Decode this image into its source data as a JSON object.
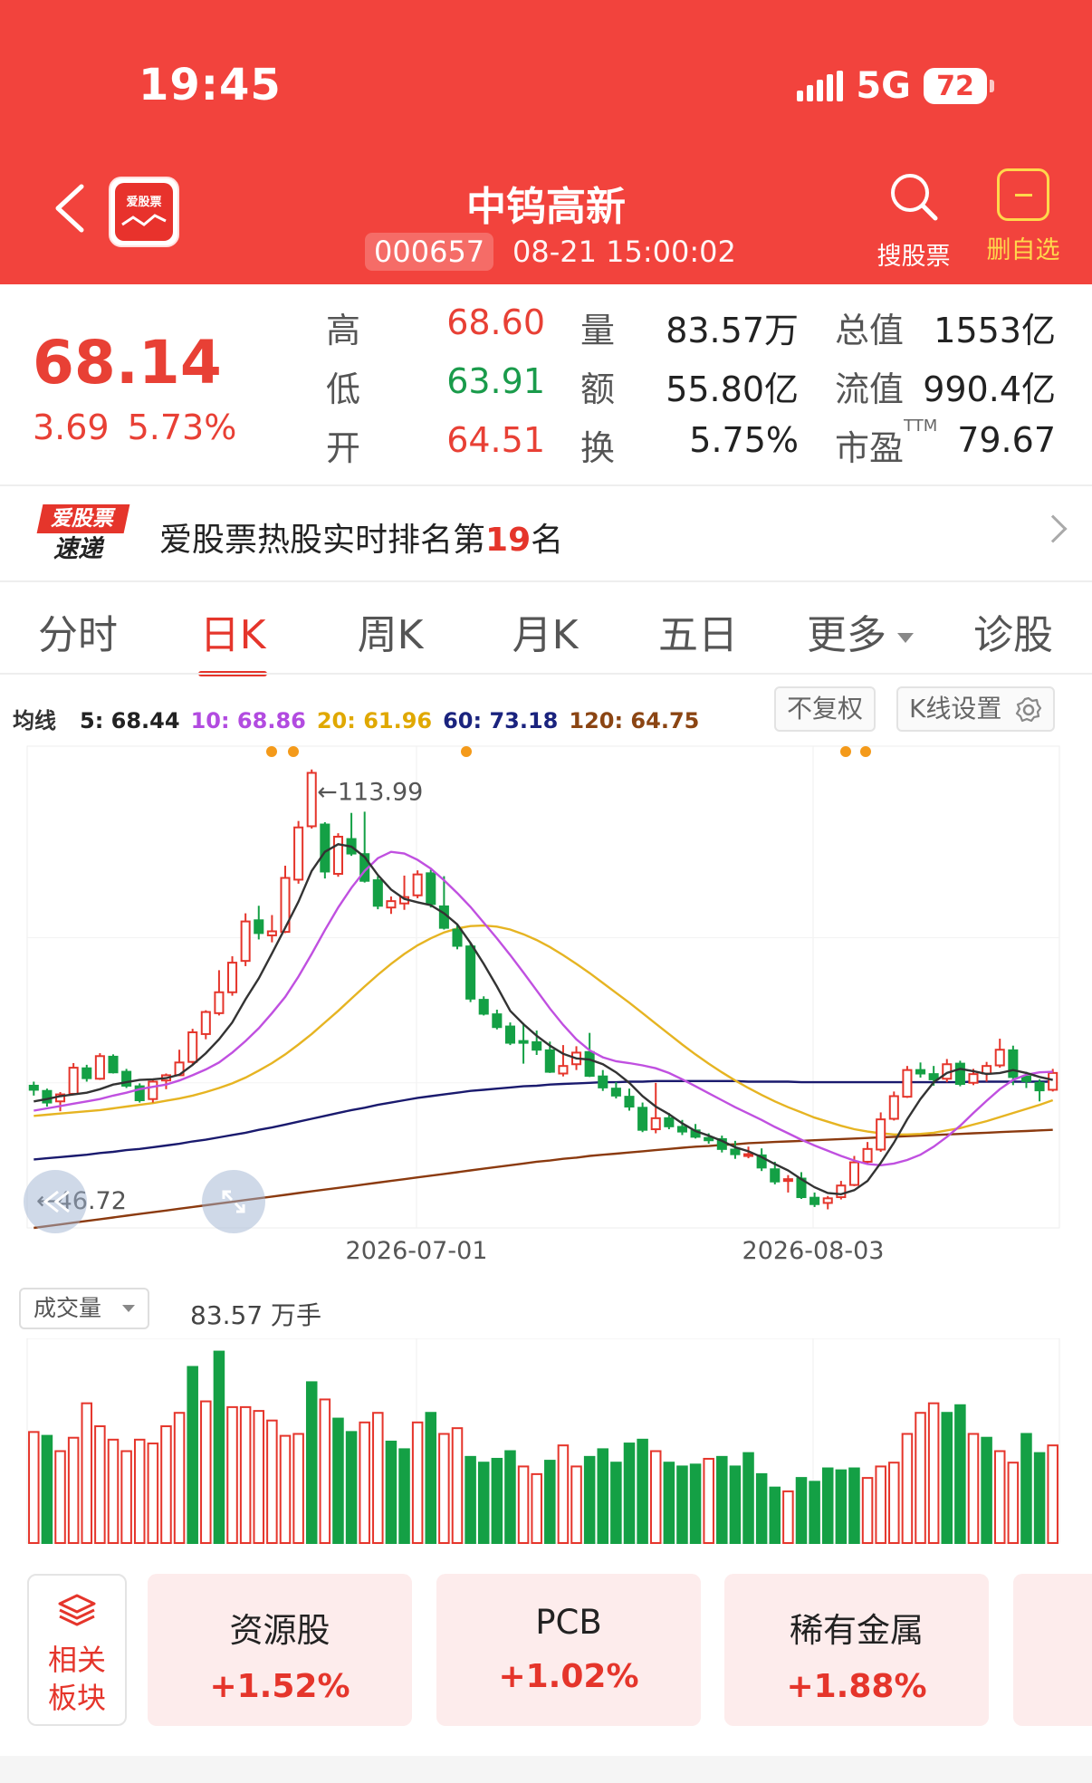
{
  "status_bar": {
    "time": "19:45",
    "network": "5G",
    "battery": "72"
  },
  "header": {
    "logo_text": "爱股票",
    "stock_name": "中钨高新",
    "stock_code": "000657",
    "timestamp": "08-21 15:00:02",
    "search_label": "搜股票",
    "remove_label": "删自选"
  },
  "quote": {
    "price": "68.14",
    "change": "3.69",
    "change_pct": "5.73%",
    "high_label": "高",
    "high": "68.60",
    "low_label": "低",
    "low": "63.91",
    "open_label": "开",
    "open": "64.51",
    "volume_label": "量",
    "volume": "83.57万",
    "amount_label": "额",
    "amount": "55.80亿",
    "turnover_label": "换",
    "turnover": "5.75%",
    "mktcap_label": "总值",
    "mktcap": "1553亿",
    "float_label": "流值",
    "float_cap": "990.4亿",
    "pe_label": "市盈",
    "pe_sup": "TTM",
    "pe": "79.67"
  },
  "hot_rank": {
    "logo_top": "爱股票",
    "logo_bottom": "速递",
    "text_prefix": "爱股票热股实时排名第",
    "rank": "19",
    "text_suffix": "名"
  },
  "tabs": [
    "分时",
    "日K",
    "周K",
    "月K",
    "五日",
    "更多",
    "诊股"
  ],
  "active_tab": 1,
  "chart_controls": {
    "adjust": "不复权",
    "settings": "K线设置"
  },
  "ma": {
    "title": "均线",
    "items": [
      {
        "label": "5: 68.44",
        "color": "#222222"
      },
      {
        "label": "10: 68.86",
        "color": "#b24be0"
      },
      {
        "label": "20: 61.96",
        "color": "#e0a800"
      },
      {
        "label": "60: 73.18",
        "color": "#1a237e"
      },
      {
        "label": "120: 64.75",
        "color": "#8b4513"
      }
    ]
  },
  "colors": {
    "up": "#e5352b",
    "down": "#14a045",
    "header": "#f2433d",
    "ma5": "#333333",
    "ma10": "#c050e0",
    "ma20": "#e6b422",
    "ma60": "#1a1a6e",
    "ma120": "#8b3a0f"
  },
  "chart_data": {
    "type": "candlestick",
    "title": "",
    "y_range": [
      46.72,
      113.99
    ],
    "max_label": "←113.99",
    "min_label": "←46.72",
    "x_tick_labels": [
      "2026-07-01",
      "2026-08-03"
    ],
    "candles": [
      [
        59.5,
        58.8,
        60.2,
        57.8
      ],
      [
        58.6,
        56.6,
        59.0,
        55.9
      ],
      [
        56.8,
        58.0,
        58.4,
        55.1
      ],
      [
        58.1,
        62.6,
        63.4,
        57.9
      ],
      [
        62.5,
        60.8,
        63.1,
        60.2
      ],
      [
        60.7,
        64.6,
        65.1,
        60.5
      ],
      [
        64.5,
        61.8,
        64.9,
        61.6
      ],
      [
        61.9,
        59.5,
        62.4,
        59.1
      ],
      [
        59.4,
        57.0,
        59.9,
        56.6
      ],
      [
        57.2,
        60.2,
        60.5,
        56.6
      ],
      [
        60.4,
        61.3,
        61.6,
        58.9
      ],
      [
        61.3,
        63.5,
        65.7,
        61.4
      ],
      [
        63.6,
        68.7,
        69.3,
        63.3
      ],
      [
        68.4,
        72.2,
        72.5,
        67.5
      ],
      [
        72.0,
        75.6,
        79.4,
        71.6
      ],
      [
        75.6,
        80.7,
        81.8,
        75.0
      ],
      [
        81.0,
        87.8,
        89.2,
        80.1
      ],
      [
        88.0,
        85.8,
        90.5,
        84.7
      ],
      [
        85.4,
        86.1,
        88.9,
        84.2
      ],
      [
        86.0,
        95.3,
        97.4,
        85.8
      ],
      [
        95.0,
        104.0,
        105.1,
        94.3
      ],
      [
        104.2,
        113.4,
        113.99,
        103.8
      ],
      [
        104.5,
        96.4,
        104.9,
        95.2
      ],
      [
        96.0,
        102.4,
        103.0,
        95.5
      ],
      [
        102.0,
        99.5,
        106.5,
        99.1
      ],
      [
        99.4,
        94.8,
        106.7,
        94.5
      ],
      [
        94.9,
        90.5,
        95.6,
        89.9
      ],
      [
        90.2,
        91.3,
        92.1,
        89.1
      ],
      [
        90.9,
        92.0,
        95.7,
        89.8
      ],
      [
        92.3,
        95.9,
        96.6,
        91.8
      ],
      [
        96.1,
        90.8,
        96.7,
        90.2
      ],
      [
        90.4,
        86.7,
        95.6,
        86.4
      ],
      [
        86.4,
        83.6,
        87.4,
        83.0
      ],
      [
        83.5,
        74.5,
        84.2,
        73.9
      ],
      [
        74.3,
        71.9,
        74.9,
        71.6
      ],
      [
        71.8,
        69.6,
        72.6,
        69.2
      ],
      [
        69.7,
        66.9,
        70.4,
        66.5
      ],
      [
        67.2,
        67.1,
        70.3,
        63.3
      ],
      [
        67.0,
        65.7,
        69.0,
        64.8
      ],
      [
        65.6,
        61.9,
        67.1,
        61.7
      ],
      [
        61.6,
        62.9,
        66.5,
        61.1
      ],
      [
        63.2,
        65.2,
        66.3,
        62.2
      ],
      [
        65.3,
        61.2,
        68.6,
        61.0
      ],
      [
        61.1,
        59.2,
        62.2,
        58.6
      ],
      [
        59.0,
        57.8,
        60.1,
        57.3
      ],
      [
        57.6,
        55.9,
        59.0,
        55.2
      ],
      [
        55.7,
        51.9,
        56.6,
        51.5
      ],
      [
        52.0,
        53.9,
        60.0,
        51.3
      ],
      [
        53.9,
        52.5,
        54.8,
        52.0
      ],
      [
        52.4,
        51.6,
        53.6,
        51.0
      ],
      [
        51.8,
        50.7,
        52.9,
        50.4
      ],
      [
        50.5,
        50.1,
        51.3,
        49.5
      ],
      [
        50.3,
        48.6,
        50.9,
        48.0
      ],
      [
        48.5,
        47.7,
        50.0,
        46.9
      ],
      [
        47.7,
        47.7,
        49.0,
        47.0
      ],
      [
        47.5,
        45.4,
        48.7,
        44.8
      ],
      [
        45.1,
        43.0,
        46.4,
        42.5
      ],
      [
        43.3,
        43.4,
        44.1,
        41.1
      ],
      [
        43.5,
        40.3,
        44.6,
        40.0
      ],
      [
        40.2,
        39.1,
        41.1,
        38.6
      ],
      [
        39.3,
        40.1,
        40.5,
        38.2
      ],
      [
        40.3,
        42.3,
        43.1,
        39.9
      ],
      [
        42.4,
        46.3,
        47.4,
        42.2
      ],
      [
        46.4,
        48.6,
        49.8,
        46.1
      ],
      [
        48.5,
        53.7,
        54.9,
        48.1
      ],
      [
        53.8,
        57.7,
        58.5,
        53.5
      ],
      [
        57.6,
        62.2,
        62.9,
        57.4
      ],
      [
        62.2,
        61.6,
        63.5,
        60.9
      ],
      [
        61.5,
        60.6,
        62.9,
        59.5
      ],
      [
        60.7,
        63.2,
        64.1,
        60.1
      ],
      [
        63.3,
        59.8,
        63.8,
        59.4
      ],
      [
        60.0,
        61.5,
        62.4,
        59.6
      ],
      [
        61.6,
        62.9,
        63.6,
        60.2
      ],
      [
        63.0,
        65.7,
        67.6,
        62.6
      ],
      [
        65.6,
        61.0,
        66.4,
        59.6
      ],
      [
        61.1,
        60.3,
        61.9,
        59.1
      ],
      [
        60.0,
        58.7,
        60.6,
        56.8
      ],
      [
        58.8,
        61.7,
        62.4,
        58.5
      ]
    ],
    "ma5": [
      56.8,
      57.2,
      57.7,
      58.0,
      58.3,
      58.9,
      59.7,
      60.1,
      60.5,
      60.6,
      60.8,
      61.4,
      63.1,
      65.1,
      67.5,
      70.4,
      74.4,
      78.0,
      82.3,
      86.7,
      91.2,
      96.5,
      99.8,
      101.1,
      100.7,
      98.9,
      95.8,
      93.3,
      91.7,
      91.1,
      90.6,
      89.2,
      87.3,
      84.1,
      80.5,
      76.6,
      72.4,
      70.1,
      68.1,
      66.4,
      65.0,
      64.2,
      64.0,
      63.2,
      61.8,
      60.0,
      57.7,
      55.9,
      54.6,
      53.0,
      51.7,
      50.9,
      50.0,
      48.9,
      48.2,
      47.2,
      46.0,
      44.9,
      43.4,
      42.0,
      41.0,
      40.8,
      41.5,
      43.1,
      46.2,
      49.7,
      53.7,
      57.2,
      60.1,
      61.7,
      62.4,
      62.0,
      61.5,
      61.7,
      62.2,
      61.7,
      61.0,
      60.5
    ],
    "ma10": [
      55.2,
      55.6,
      56.0,
      56.4,
      56.8,
      57.2,
      57.8,
      58.3,
      58.9,
      59.3,
      59.7,
      60.4,
      61.3,
      62.3,
      63.5,
      65.2,
      67.2,
      69.4,
      72.0,
      74.8,
      78.3,
      82.2,
      86.3,
      90.2,
      93.6,
      96.5,
      98.7,
      99.8,
      99.5,
      98.4,
      96.9,
      94.9,
      92.7,
      90.3,
      87.6,
      84.9,
      82.0,
      79.0,
      75.9,
      72.8,
      70.0,
      67.5,
      65.6,
      64.4,
      63.7,
      63.4,
      63.0,
      62.5,
      61.7,
      60.6,
      59.4,
      58.2,
      57.0,
      55.8,
      54.7,
      53.6,
      52.4,
      51.3,
      50.2,
      49.2,
      48.3,
      47.4,
      46.6,
      46.0,
      45.8,
      46.1,
      46.7,
      47.6,
      49.0,
      50.7,
      52.6,
      54.8,
      56.9,
      58.9,
      60.5,
      61.4,
      61.8,
      61.9
    ],
    "ma20": [
      54.3,
      54.5,
      54.7,
      54.9,
      55.1,
      55.3,
      55.6,
      55.9,
      56.2,
      56.5,
      56.9,
      57.3,
      57.8,
      58.4,
      59.1,
      59.9,
      60.9,
      62.1,
      63.4,
      64.9,
      66.6,
      68.4,
      70.4,
      72.4,
      74.5,
      76.6,
      78.6,
      80.5,
      82.2,
      83.7,
      84.9,
      85.9,
      86.6,
      87.0,
      87.1,
      86.9,
      86.4,
      85.6,
      84.6,
      83.4,
      82.0,
      80.5,
      78.9,
      77.2,
      75.5,
      73.8,
      72.0,
      70.2,
      68.4,
      66.6,
      64.9,
      63.3,
      61.8,
      60.4,
      59.1,
      57.9,
      56.8,
      55.8,
      54.9,
      54.0,
      53.3,
      52.6,
      52.0,
      51.6,
      51.3,
      51.1,
      51.1,
      51.2,
      51.4,
      51.8,
      52.2,
      52.8,
      53.4,
      54.1,
      54.8,
      55.5,
      56.2,
      57.0
    ],
    "ma60": [
      46.8,
      47.0,
      47.2,
      47.4,
      47.6,
      47.9,
      48.1,
      48.4,
      48.6,
      48.9,
      49.2,
      49.5,
      49.9,
      50.2,
      50.6,
      51.0,
      51.4,
      51.9,
      52.3,
      52.8,
      53.3,
      53.8,
      54.3,
      54.8,
      55.3,
      55.7,
      56.2,
      56.6,
      57.0,
      57.4,
      57.7,
      58.0,
      58.3,
      58.6,
      58.8,
      59.0,
      59.2,
      59.4,
      59.5,
      59.7,
      59.8,
      59.9,
      60.0,
      60.1,
      60.1,
      60.2,
      60.2,
      60.3,
      60.3,
      60.3,
      60.3,
      60.3,
      60.3,
      60.3,
      60.2,
      60.2,
      60.2,
      60.2,
      60.1,
      60.1,
      60.1,
      60.1,
      60.1,
      60.1,
      60.1,
      60.1,
      60.1,
      60.1,
      60.1,
      60.1,
      60.1,
      60.2,
      60.2,
      60.2,
      60.2,
      60.2,
      60.2,
      60.2
    ],
    "ma120": [
      35.0,
      35.3,
      35.6,
      35.9,
      36.2,
      36.5,
      36.8,
      37.1,
      37.4,
      37.7,
      38.0,
      38.3,
      38.6,
      38.9,
      39.2,
      39.5,
      39.8,
      40.1,
      40.4,
      40.7,
      41.0,
      41.3,
      41.6,
      41.9,
      42.2,
      42.5,
      42.8,
      43.1,
      43.4,
      43.7,
      44.0,
      44.3,
      44.6,
      44.9,
      45.2,
      45.5,
      45.8,
      46.1,
      46.4,
      46.6,
      46.9,
      47.1,
      47.4,
      47.6,
      47.8,
      48.0,
      48.2,
      48.4,
      48.6,
      48.8,
      49.0,
      49.1,
      49.3,
      49.4,
      49.6,
      49.7,
      49.8,
      49.9,
      50.0,
      50.1,
      50.2,
      50.3,
      50.4,
      50.5,
      50.6,
      50.7,
      50.8,
      50.9,
      51.0,
      51.1,
      51.2,
      51.3,
      51.4,
      51.5,
      51.6,
      51.7,
      51.8,
      51.9
    ],
    "volume_label": "成交量",
    "volume_current": "83.57 万手",
    "volume": [
      58,
      56,
      48,
      55,
      73,
      61,
      54,
      48,
      54,
      52,
      61,
      68,
      92,
      74,
      100,
      71,
      71,
      69,
      64,
      56,
      57,
      84,
      75,
      65,
      58,
      63,
      68,
      53,
      49,
      63,
      68,
      57,
      60,
      45,
      42,
      44,
      48,
      40,
      36,
      43,
      51,
      40,
      45,
      49,
      42,
      52,
      54,
      48,
      42,
      40,
      41,
      44,
      45,
      40,
      47,
      36,
      29,
      27,
      34,
      32,
      39,
      38,
      39,
      34,
      40,
      42,
      57,
      68,
      73,
      68,
      72,
      57,
      55,
      48,
      42,
      57,
      47,
      51
    ],
    "volume_up": [
      true,
      false,
      true,
      true,
      true,
      true,
      true,
      true,
      true,
      true,
      true,
      true,
      false,
      true,
      false,
      true,
      true,
      true,
      true,
      true,
      true,
      false,
      true,
      false,
      false,
      true,
      true,
      false,
      false,
      true,
      false,
      true,
      true,
      false,
      false,
      false,
      false,
      true,
      true,
      false,
      true,
      true,
      false,
      false,
      false,
      false,
      false,
      true,
      false,
      false,
      false,
      true,
      false,
      false,
      false,
      false,
      false,
      true,
      false,
      false,
      false,
      false,
      false,
      true,
      true,
      true,
      true,
      true,
      true,
      false,
      false,
      true,
      false,
      true,
      true,
      false,
      false,
      true
    ]
  },
  "sectors": {
    "related_label_1": "相关",
    "related_label_2": "板块",
    "items": [
      {
        "name": "资源股",
        "pct": "+1.52%"
      },
      {
        "name": "PCB",
        "pct": "+1.02%"
      },
      {
        "name": "稀有金属",
        "pct": "+1.88%"
      }
    ]
  }
}
